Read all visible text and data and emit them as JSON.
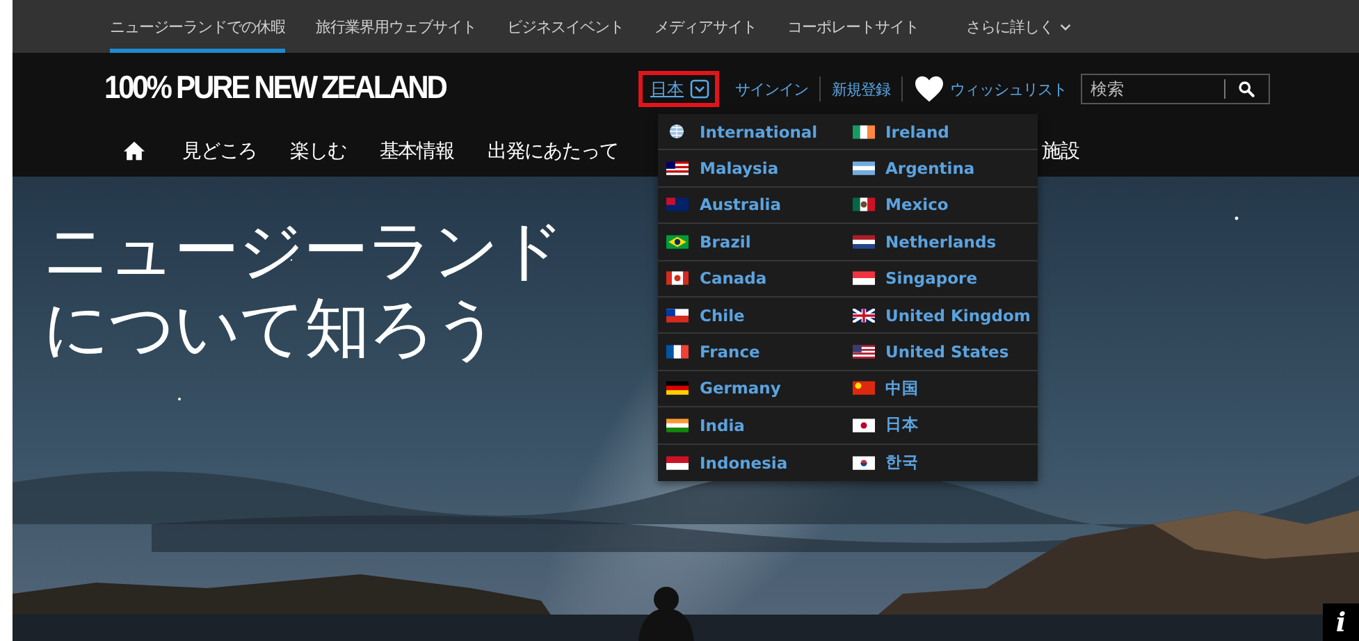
{
  "top_bar": {
    "items": [
      {
        "label": "ニュージーランドでの休暇",
        "selected": true
      },
      {
        "label": "旅行業界用ウェブサイト",
        "selected": false
      },
      {
        "label": "ビジネスイベント",
        "selected": false
      },
      {
        "label": "メディアサイト",
        "selected": false
      },
      {
        "label": "コーポレートサイト",
        "selected": false
      },
      {
        "label": "さらに詳しく",
        "selected": false
      }
    ]
  },
  "header": {
    "logo": "100% PURE NEW ZEALAND",
    "language": "日本",
    "sign_in": "サインイン",
    "register": "新規登録",
    "wishlist": "ウィッシュリスト",
    "search": {
      "placeholder": "検索"
    }
  },
  "nav": {
    "items": [
      "見どころ",
      "楽しむ",
      "基本情報",
      "出発にあたって",
      "施設"
    ]
  },
  "language_menu": {
    "columns": [
      [
        "International",
        "Malaysia",
        "Australia",
        "Brazil",
        "Canada",
        "Chile",
        "France",
        "Germany",
        "India",
        "Indonesia"
      ],
      [
        "Ireland",
        "Argentina",
        "Mexico",
        "Netherlands",
        "Singapore",
        "United Kingdom",
        "United States",
        "中国",
        "日本",
        "한국"
      ]
    ]
  },
  "hero": {
    "kind": "picture",
    "title": [
      "ニュージーランド",
      "について知ろう"
    ],
    "info": "i"
  }
}
